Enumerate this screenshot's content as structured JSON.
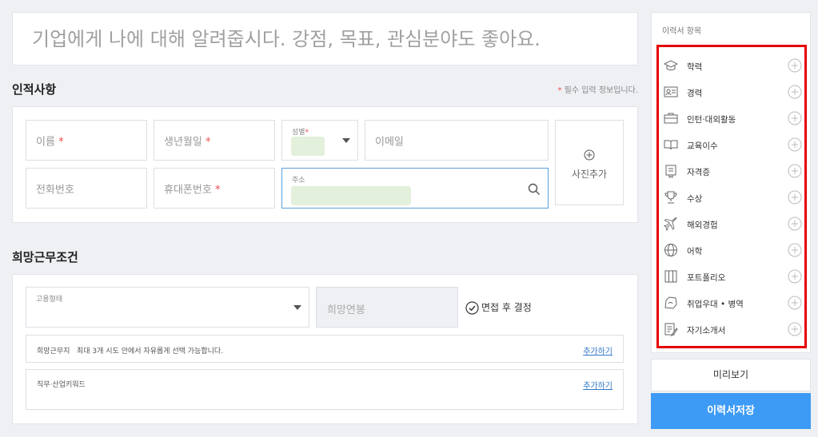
{
  "intro": {
    "placeholder": "기업에게 나에 대해 알려줍시다. 강점, 목표, 관심분야도 좋아요."
  },
  "personal": {
    "title": "인적사항",
    "required_star": "*",
    "required_note": "필수 입력 정보입니다.",
    "name_label": "이름",
    "birth_label": "생년월일",
    "gender_label": "성별",
    "email_label": "이메일",
    "phone_label": "전화번호",
    "mobile_label": "휴대폰번호",
    "address_label": "주소",
    "photo_label": "사진추가",
    "star": "*"
  },
  "work": {
    "title": "희망근무조건",
    "employment_label": "고용형태",
    "salary_label": "희망연봉",
    "decide_label": "면접 후 결정",
    "location_label": "희망근무지",
    "location_hint": "최대 3개 시도 안에서 자유롭게 선택 가능합니다.",
    "location_add": "추가하기",
    "keyword_label": "직무·산업키워드",
    "keyword_add": "추가하기"
  },
  "sidebar": {
    "title": "이력서 항목",
    "items": [
      {
        "label": "학력",
        "icon": "graduation-cap-icon"
      },
      {
        "label": "경력",
        "icon": "id-card-icon"
      },
      {
        "label": "인턴·대외활동",
        "icon": "briefcase-icon"
      },
      {
        "label": "교육이수",
        "icon": "book-icon"
      },
      {
        "label": "자격증",
        "icon": "certificate-icon"
      },
      {
        "label": "수상",
        "icon": "trophy-icon"
      },
      {
        "label": "해외경험",
        "icon": "airplane-icon"
      },
      {
        "label": "어학",
        "icon": "globe-icon"
      },
      {
        "label": "포트폴리오",
        "icon": "portfolio-icon"
      },
      {
        "label": "취업우대 • 병역",
        "icon": "preference-icon"
      },
      {
        "label": "자기소개서",
        "icon": "document-icon"
      }
    ]
  },
  "actions": {
    "preview": "미리보기",
    "save": "이력서저장"
  },
  "colors": {
    "accent": "#3d9bf5",
    "required": "#e84a4a",
    "highlight_border": "#e60000",
    "link": "#2f77c9"
  }
}
